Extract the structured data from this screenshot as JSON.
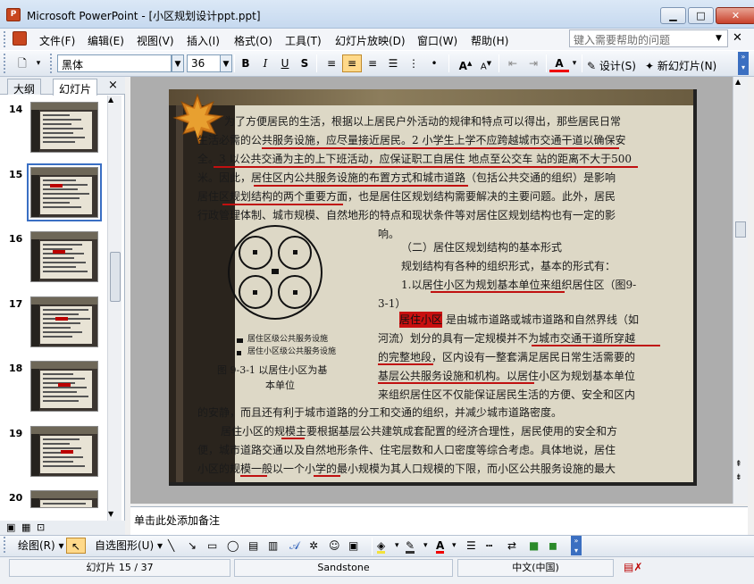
{
  "window": {
    "title": "Microsoft PowerPoint - [小区规划设计ppt.ppt]",
    "app_icon": "P",
    "minimize": "▁",
    "maximize": "□",
    "close": "✕"
  },
  "menu": {
    "items": [
      "文件(F)",
      "编辑(E)",
      "视图(V)",
      "插入(I)",
      "格式(O)",
      "工具(T)",
      "幻灯片放映(D)",
      "窗口(W)",
      "帮助(H)"
    ],
    "help_placeholder": "键入需要帮助的问题"
  },
  "toolbar": {
    "font": "黑体",
    "font_size": "36",
    "design": "设计(S)",
    "new_slide": "新幻灯片(N)"
  },
  "panel": {
    "tab_outline": "大纲",
    "tab_slides": "幻灯片",
    "close": "×",
    "selected_slide": 15
  },
  "thumbs": [
    {
      "num": "14"
    },
    {
      "num": "15"
    },
    {
      "num": "16"
    },
    {
      "num": "17"
    },
    {
      "num": "18"
    },
    {
      "num": "19"
    },
    {
      "num": "20"
    }
  ],
  "slide": {
    "lines": [
      "为了方便居民的生活，根据以上居民户外活动的规律和特点可以得出，那些居民日常",
      "生活必需的公共服务设施，应尽量接近居民。2 小学生上学不应跨越城市交通干道以确保安",
      "全。3 以公共交通为主的上下班活动，应保证职工自居住 地点至公交车 站的距离不大于500",
      "米。因此，居住区内公共服务设施的布置方式和城市道路（包括公共交通的组织）是影响",
      "居住区规划结构的两个重要方面，也是居住区规划结构需要解决的主要问题。此外，居民",
      "行政管理体制、城市规模、自然地形的特点和现状条件等对居住区规划结构也有一定的影",
      "响。"
    ],
    "heading": "（二）居住区规划结构的基本形式",
    "p2_1": "规划结构有各种的组织形式，基本的形式有：",
    "p2_2": "1.以居住小区为规划基本单位来组织居住区（图9-",
    "p2_3": "3-1）",
    "hl_word": "居住小区",
    "p3": [
      "是由城市道路或城市道路和自然界线（如",
      "河流）划分的具有一定规模并不为城市交通干道所穿越",
      "的完整地段，区内设有一整套满足居民日常生活需要的",
      "基层公共服务设施和机构。以居住小区为规划基本单位",
      "来组织居住区不仅能保证居民生活的方便、安全和区内"
    ],
    "legend1": "居住区级公共服务设施",
    "legend2": "居住小区级公共服务设施",
    "fig_caption1": "图 9-3-1  以居住小区为基",
    "fig_caption2": "本单位",
    "p4": [
      "的安静，而且还有利于城市道路的分工和交通的组织，并减少城市道路密度。",
      "居住小区的规模主要根据基层公共建筑成套配置的经济合理性，居民使用的安全和方",
      "便，城市道路交通以及自然地形条件、住宅层数和人口密度等综合考虑。具体地说，居住",
      "小区的规模一般以一个小学的最小规模为其人口规模的下限，而小区公共服务设施的最大"
    ]
  },
  "notes": {
    "placeholder": "单击此处添加备注"
  },
  "draw": {
    "draw": "绘图(R)",
    "autoshape": "自选图形(U)"
  },
  "status": {
    "slide": "幻灯片 15 / 37",
    "design": "Sandstone",
    "lang": "中文(中国)"
  }
}
